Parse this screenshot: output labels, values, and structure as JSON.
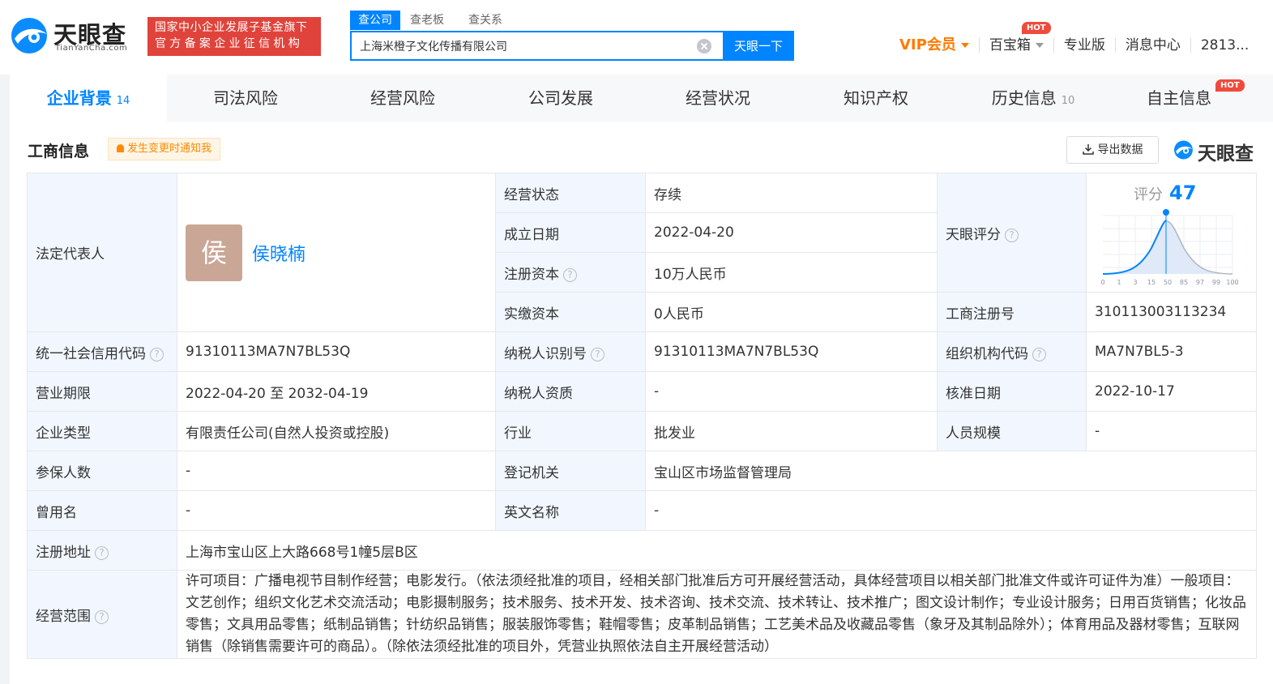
{
  "header": {
    "logo_cn": "天眼查",
    "logo_en": "TianYanCha.com",
    "badge_line1": "国家中小企业发展子基金旗下",
    "badge_line2": "官方备案企业征信机构",
    "search_tabs": [
      "查公司",
      "查老板",
      "查关系"
    ],
    "search_value": "上海米橙子文化传播有限公司",
    "search_button": "天眼一下",
    "nav": {
      "vip": "VIP会员",
      "baobox": "百宝箱",
      "hot": "HOT",
      "pro": "专业版",
      "messages": "消息中心",
      "user": "2813..."
    }
  },
  "tabs": [
    {
      "label": "企业背景",
      "count": "14"
    },
    {
      "label": "司法风险",
      "count": ""
    },
    {
      "label": "经营风险",
      "count": ""
    },
    {
      "label": "公司发展",
      "count": ""
    },
    {
      "label": "经营状况",
      "count": ""
    },
    {
      "label": "知识产权",
      "count": ""
    },
    {
      "label": "历史信息",
      "count": "10"
    },
    {
      "label": "自主信息",
      "count": ""
    }
  ],
  "tab_hot": "HOT",
  "section": {
    "title": "工商信息",
    "notify": "发生变更时通知我",
    "export": "导出数据",
    "watermark": "天眼查"
  },
  "info": {
    "legal_rep_label": "法定代表人",
    "legal_rep_avatar": "侯",
    "legal_rep_name": "侯晓楠",
    "status_label": "经营状态",
    "status": "存续",
    "founded_label": "成立日期",
    "founded": "2022-04-20",
    "reg_capital_label": "注册资本",
    "reg_capital": "10万人民币",
    "paid_capital_label": "实缴资本",
    "paid_capital": "0人民币",
    "score_label": "天眼评分",
    "score_text": "评分",
    "score": "47",
    "score_axis": [
      "0",
      "1",
      "3",
      "15",
      "50",
      "85",
      "97",
      "99",
      "100"
    ],
    "reg_no_label": "工商注册号",
    "reg_no": "310113003113234",
    "credit_code_label": "统一社会信用代码",
    "credit_code": "91310113MA7N7BL53Q",
    "taxpayer_id_label": "纳税人识别号",
    "taxpayer_id": "91310113MA7N7BL53Q",
    "org_code_label": "组织机构代码",
    "org_code": "MA7N7BL5-3",
    "term_label": "营业期限",
    "term": "2022-04-20 至 2032-04-19",
    "taxpayer_qual_label": "纳税人资质",
    "taxpayer_qual": "-",
    "approved_label": "核准日期",
    "approved": "2022-10-17",
    "type_label": "企业类型",
    "type": "有限责任公司(自然人投资或控股)",
    "industry_label": "行业",
    "industry": "批发业",
    "staff_label": "人员规模",
    "staff": "-",
    "insured_label": "参保人数",
    "insured": "-",
    "authority_label": "登记机关",
    "authority": "宝山区市场监督管理局",
    "former_label": "曾用名",
    "former": "-",
    "english_label": "英文名称",
    "english": "-",
    "address_label": "注册地址",
    "address": "上海市宝山区上大路668号1幢5层B区",
    "scope_label": "经营范围",
    "scope": "许可项目：广播电视节目制作经营；电影发行。（依法须经批准的项目，经相关部门批准后方可开展经营活动，具体经营项目以相关部门批准文件或许可证件为准）一般项目：文艺创作；组织文化艺术交流活动；电影摄制服务；技术服务、技术开发、技术咨询、技术交流、技术转让、技术推广；图文设计制作；专业设计服务；日用百货销售；化妆品零售；文具用品零售；纸制品销售；针纺织品销售；服装服饰零售；鞋帽零售；皮革制品销售；工艺美术品及收藏品零售（象牙及其制品除外）；体育用品及器材零售；互联网销售（除销售需要许可的商品）。（除依法须经批准的项目外，凭营业执照依法自主开展经营活动）"
  },
  "colors": {
    "accent": "#0084ff",
    "badge": "#e0433b",
    "vip": "#ff7a00",
    "label_bg": "#f2f7ff"
  }
}
